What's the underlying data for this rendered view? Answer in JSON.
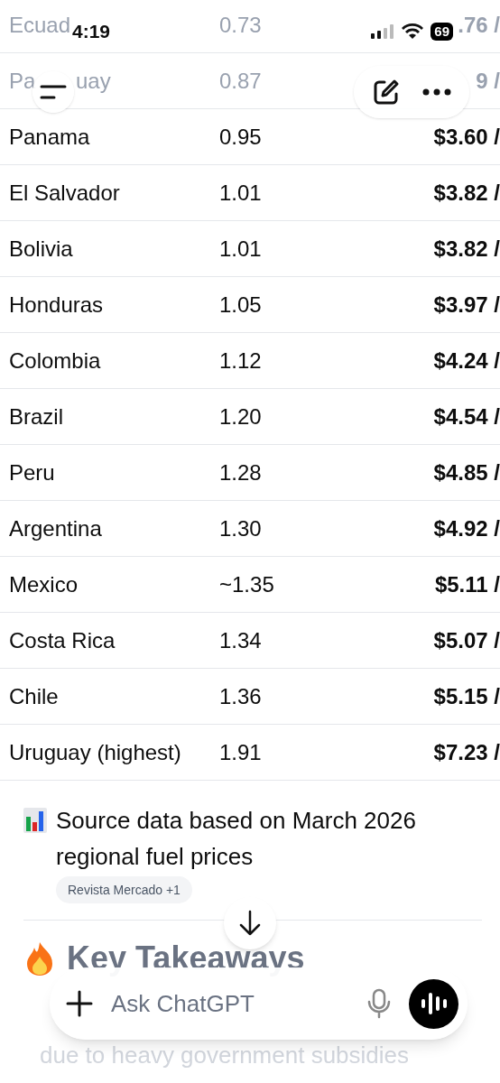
{
  "status_bar": {
    "time": "4:19",
    "battery": "69"
  },
  "table": {
    "rows": [
      {
        "country": "Ecuad",
        "value": "0.73",
        "price": ".76 /"
      },
      {
        "country_fragments": [
          "Pa",
          "uay"
        ],
        "value": "0.87",
        "price": "9 /"
      },
      {
        "country": "Panama",
        "value": "0.95",
        "price": "$3.60 /"
      },
      {
        "country": "El Salvador",
        "value": "1.01",
        "price": "$3.82 /"
      },
      {
        "country": "Bolivia",
        "value": "1.01",
        "price": "$3.82 /"
      },
      {
        "country": "Honduras",
        "value": "1.05",
        "price": "$3.97 /"
      },
      {
        "country": "Colombia",
        "value": "1.12",
        "price": "$4.24 /"
      },
      {
        "country": "Brazil",
        "value": "1.20",
        "price": "$4.54 /"
      },
      {
        "country": "Peru",
        "value": "1.28",
        "price": "$4.85 /"
      },
      {
        "country": "Argentina",
        "value": "1.30",
        "price": "$4.92 /"
      },
      {
        "country": "Mexico",
        "value": "~1.35",
        "price": "$5.11 /"
      },
      {
        "country": "Costa Rica",
        "value": "1.34",
        "price": "$5.07 /"
      },
      {
        "country": "Chile",
        "value": "1.36",
        "price": "$5.15 /"
      },
      {
        "country": "Uruguay (highest)",
        "value": "1.91",
        "price": "$7.23 /"
      }
    ]
  },
  "note": {
    "text": "Source data based on March 2026 regional fuel prices",
    "source_chip": "Revista Mercado +1"
  },
  "section": {
    "heading": "Key Takeaways",
    "line": "due to heavy government subsidies"
  },
  "composer": {
    "placeholder": "Ask ChatGPT"
  }
}
